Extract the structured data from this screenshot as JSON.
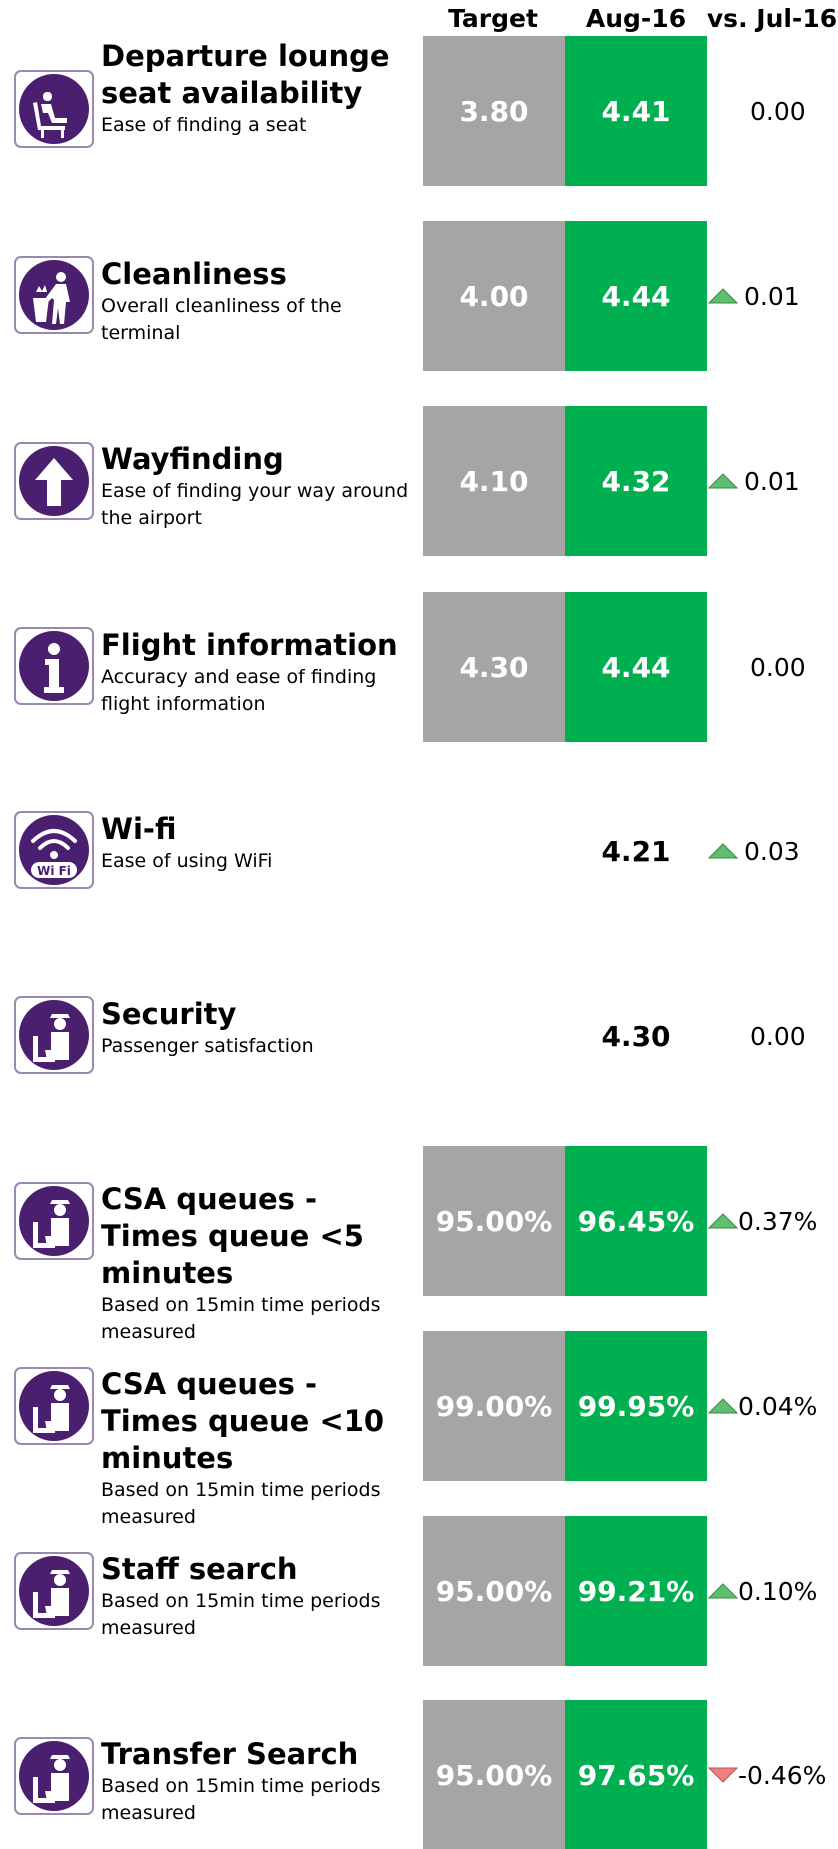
{
  "header": {
    "target": "Target",
    "month": "Aug-16",
    "vs": "vs. Jul-16"
  },
  "colors": {
    "target": "#a5a5a5",
    "actual": "#00b050",
    "icon": "#4b1f6f",
    "up": "#5fbf6f",
    "down": "#f08080"
  },
  "rows": [
    {
      "icon": "seat-icon",
      "title": "Departure lounge seat availability",
      "subtitle": "Ease of finding a seat",
      "target": "3.80",
      "actual": "4.41",
      "change": "0.00",
      "trend": "none"
    },
    {
      "icon": "bin-icon",
      "title": "Cleanliness",
      "subtitle": "Overall cleanliness of the terminal",
      "target": "4.00",
      "actual": "4.44",
      "change": "0.01",
      "trend": "up"
    },
    {
      "icon": "arrow-up-icon",
      "title": "Wayfinding",
      "subtitle": "Ease of finding your way around the airport",
      "target": "4.10",
      "actual": "4.32",
      "change": "0.01",
      "trend": "up"
    },
    {
      "icon": "info-icon",
      "title": "Flight information",
      "subtitle": "Accuracy and ease of finding flight information",
      "target": "4.30",
      "actual": "4.44",
      "change": "0.00",
      "trend": "none"
    },
    {
      "icon": "wifi-icon",
      "title": "Wi-fi",
      "subtitle": "Ease of using WiFi",
      "target": "",
      "actual": "4.21",
      "change": "0.03",
      "trend": "up"
    },
    {
      "icon": "security-officer-icon",
      "title": "Security",
      "subtitle": "Passenger satisfaction",
      "target": "",
      "actual": "4.30",
      "change": "0.00",
      "trend": "none"
    },
    {
      "icon": "security-officer-icon",
      "title": "CSA queues - Times queue <5 minutes",
      "subtitle": "Based on 15min time periods measured",
      "target": "95.00%",
      "actual": "96.45%",
      "change": "0.37%",
      "trend": "up"
    },
    {
      "icon": "security-officer-icon",
      "title": "CSA queues - Times queue <10 minutes",
      "subtitle": "Based on 15min time periods measured",
      "target": "99.00%",
      "actual": "99.95%",
      "change": "0.04%",
      "trend": "up"
    },
    {
      "icon": "security-officer-icon",
      "title": "Staff search",
      "subtitle": "Based on 15min time periods measured",
      "target": "95.00%",
      "actual": "99.21%",
      "change": "0.10%",
      "trend": "up"
    },
    {
      "icon": "security-officer-icon",
      "title": "Transfer Search",
      "subtitle": "Based on 15min time periods measured",
      "target": "95.00%",
      "actual": "97.65%",
      "change": "-0.46%",
      "trend": "down"
    }
  ]
}
